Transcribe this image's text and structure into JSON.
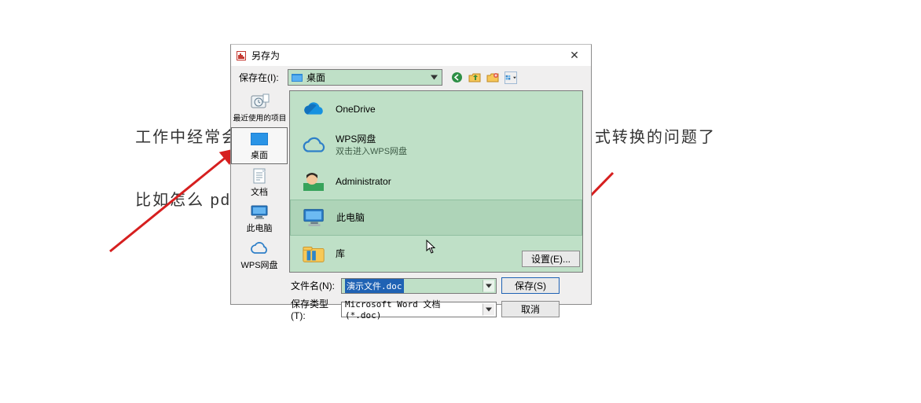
{
  "background": {
    "line1": "工作中经常会遇                                                         式转换的问题了",
    "line2": "比如怎么 pdf 转"
  },
  "dialog": {
    "title": "另存为",
    "close_glyph": "✕",
    "location_label": "保存在(I):",
    "current_location": "桌面",
    "sidebar": [
      {
        "key": "recent",
        "label": "最近使用的项目"
      },
      {
        "key": "desktop",
        "label": "桌面"
      },
      {
        "key": "docs",
        "label": "文档"
      },
      {
        "key": "thispc",
        "label": "此电脑"
      },
      {
        "key": "wps",
        "label": "WPS网盘"
      }
    ],
    "places": [
      {
        "key": "onedrive",
        "label": "OneDrive",
        "sub": ""
      },
      {
        "key": "wps",
        "label": "WPS网盘",
        "sub": "双击进入WPS网盘"
      },
      {
        "key": "admin",
        "label": "Administrator",
        "sub": ""
      },
      {
        "key": "thispc",
        "label": "此电脑",
        "sub": "",
        "highlight": true
      },
      {
        "key": "lib",
        "label": "库",
        "sub": ""
      }
    ],
    "filename_label": "文件名(N):",
    "filename_value": "演示文件.doc",
    "filetype_label": "保存类型(T):",
    "filetype_value": "Microsoft Word 文档 (*.doc)",
    "settings_label": "设置(E)...",
    "save_label": "保存(S)",
    "cancel_label": "取消"
  }
}
